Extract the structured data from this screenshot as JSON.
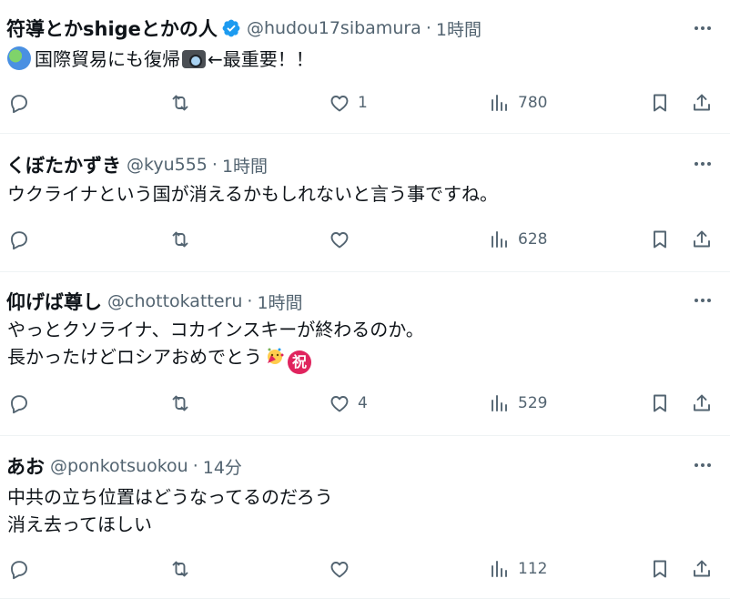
{
  "replies": [
    {
      "name": "符導とかshigeとかの人",
      "verified": true,
      "handle": "@hudou17sibamura",
      "separator": "·",
      "time": "1時間",
      "lines": [
        "国際貿易にも復帰",
        "←最重要！！"
      ],
      "emoji": [
        "globe-emoji",
        "camera-emoji"
      ],
      "likes": "1",
      "views": "780"
    },
    {
      "name": "くぼたかずき",
      "verified": false,
      "handle": "@kyu555",
      "separator": "·",
      "time": "1時間",
      "lines": [
        "ウクライナという国が消えるかもしれないと言う事ですね。"
      ],
      "likes": "",
      "views": "628"
    },
    {
      "name": "仰げば尊し",
      "verified": false,
      "handle": "@chottokatteru",
      "separator": "·",
      "time": "1時間",
      "lines": [
        "やっとクソライナ、コカインスキーが終わるのか。",
        "長かったけどロシアおめでとう"
      ],
      "emoji": [
        "party-emoji",
        "iwai-emoji"
      ],
      "iwai_char": "祝",
      "likes": "4",
      "views": "529"
    },
    {
      "name": "あお",
      "verified": false,
      "handle": "@ponkotsuokou",
      "separator": "·",
      "time": "14分",
      "lines": [
        "中共の立ち位置はどうなってるのだろう",
        "消え去ってほしい"
      ],
      "likes": "",
      "views": "112"
    }
  ],
  "colors": {
    "text": "#0f1419",
    "secondary": "#536471",
    "verified": "#1d9bf0",
    "divider": "#eff3f4"
  },
  "icons": [
    "reply-icon",
    "retweet-icon",
    "like-icon",
    "views-icon",
    "bookmark-icon",
    "share-icon",
    "more-icon",
    "verified-badge-icon"
  ]
}
